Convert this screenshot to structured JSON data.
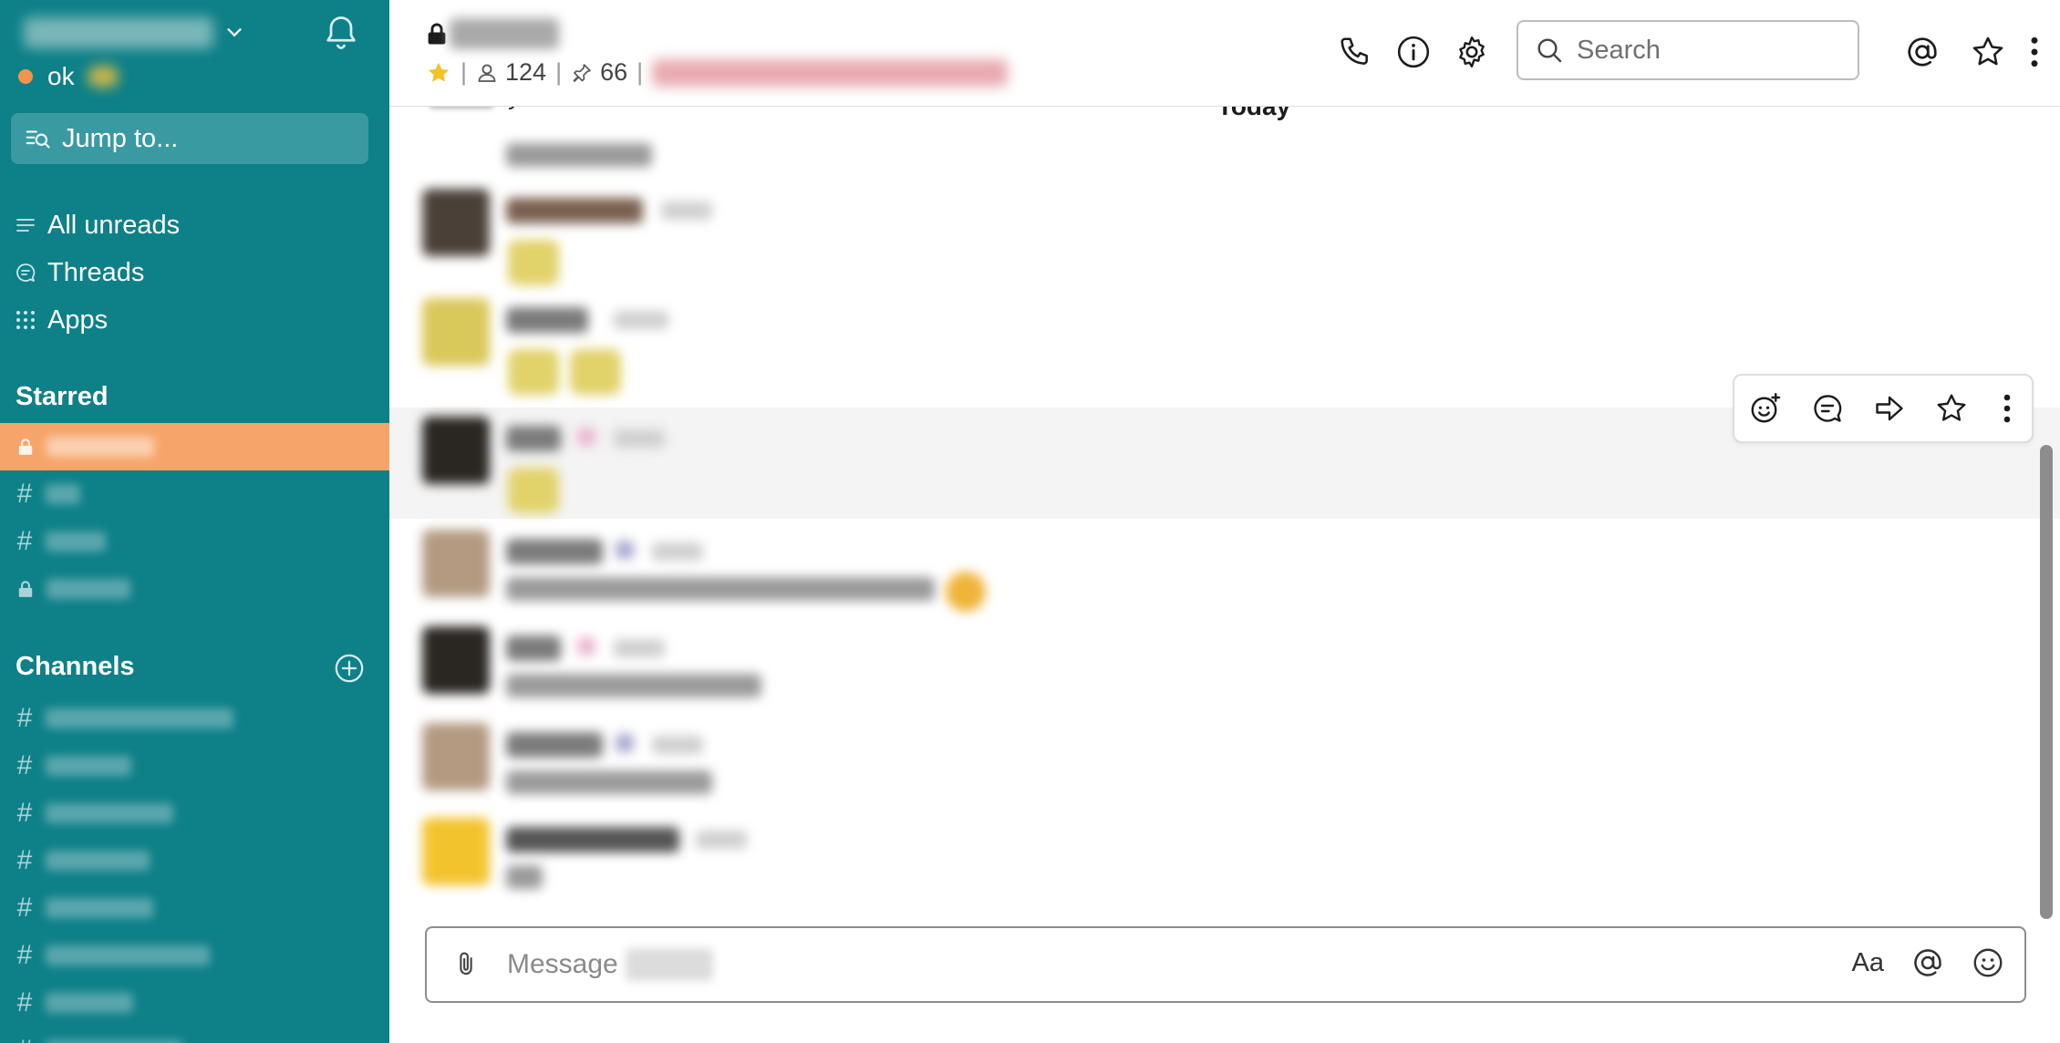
{
  "sidebar": {
    "status_text": "ok",
    "jump_to_placeholder": "Jump to...",
    "nav": {
      "all_unreads": "All unreads",
      "threads": "Threads",
      "apps": "Apps"
    },
    "starred_title": "Starred",
    "channels_title": "Channels",
    "channel_prefix": "#",
    "starred_channels": [
      {
        "type": "private"
      },
      {
        "type": "public"
      },
      {
        "type": "public"
      },
      {
        "type": "private"
      }
    ],
    "channels_count_visible": 7,
    "colors": {
      "background": "#0e8088",
      "active_item": "#f7a46a",
      "presence_away": "#f2954a"
    }
  },
  "header": {
    "member_count": "124",
    "pinned_count": "66",
    "search_placeholder": "Search"
  },
  "messages": {
    "divider_label": "Today",
    "partial_top_text": "yeah"
  },
  "composer": {
    "placeholder": "Message",
    "format_label": "Aa"
  },
  "icons": [
    "chevron-down-icon",
    "bell-icon",
    "jump-to-icon",
    "all-unreads-icon",
    "threads-icon",
    "apps-icon",
    "lock-icon",
    "hash-icon",
    "add-channel-icon",
    "star-icon",
    "member-icon",
    "pin-icon",
    "phone-icon",
    "info-icon",
    "gear-icon",
    "search-icon",
    "mention-icon",
    "more-vertical-icon",
    "add-reaction-icon",
    "reply-thread-icon",
    "share-icon",
    "save-star-icon",
    "paperclip-icon",
    "emoji-icon"
  ]
}
